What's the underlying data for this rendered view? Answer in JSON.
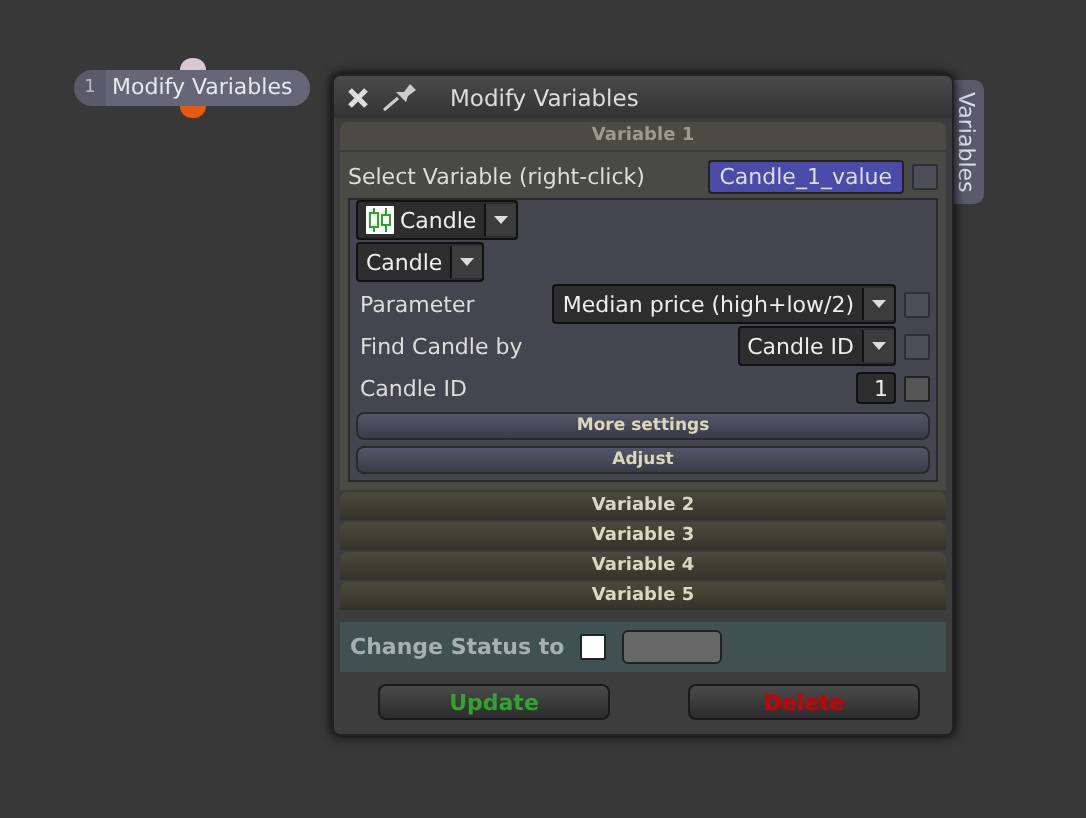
{
  "node": {
    "number": "1",
    "label": "Modify Variables"
  },
  "window": {
    "title": "Modify Variables",
    "side_tab": "Variables"
  },
  "sections": [
    {
      "title": "Variable 1",
      "expanded": true
    },
    {
      "title": "Variable 2",
      "expanded": false
    },
    {
      "title": "Variable 3",
      "expanded": false
    },
    {
      "title": "Variable 4",
      "expanded": false
    },
    {
      "title": "Variable 5",
      "expanded": false
    }
  ],
  "select_variable": {
    "label": "Select Variable (right-click)",
    "value": "Candle_1_value",
    "checked": false
  },
  "type_dropdown": {
    "value": "Candle"
  },
  "subtype_dropdown": {
    "value": "Candle"
  },
  "fields": [
    {
      "kind": "dropdown",
      "label": "Parameter",
      "value": "Median price (high+low/2)",
      "checked": false
    },
    {
      "kind": "dropdown",
      "label": "Find Candle by",
      "value": "Candle ID",
      "checked": false
    },
    {
      "kind": "input",
      "label": "Candle ID",
      "value": "1",
      "checked": false
    }
  ],
  "panel_buttons": [
    "More settings",
    "Adjust"
  ],
  "status": {
    "label": "Change Status to",
    "checked": false
  },
  "buttons": [
    {
      "label": "Update",
      "kind": "update"
    },
    {
      "label": "Delete",
      "kind": "delete"
    }
  ]
}
